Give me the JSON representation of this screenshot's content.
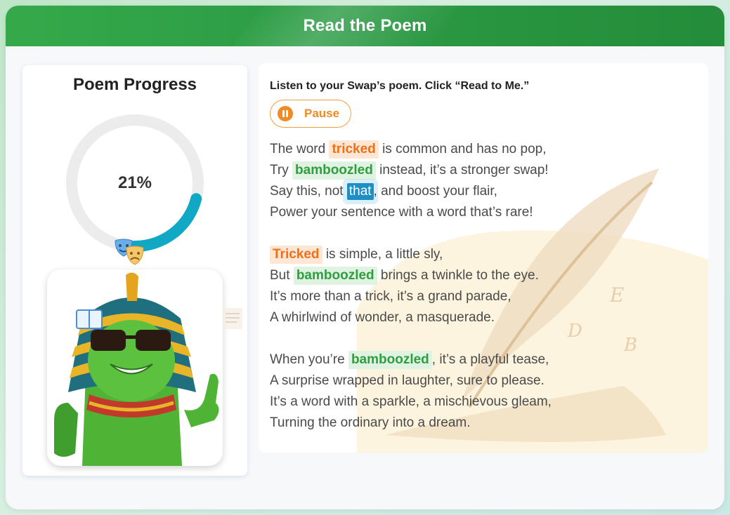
{
  "header": {
    "title": "Read the Poem"
  },
  "progress": {
    "title": "Poem Progress",
    "percent_label": "21%",
    "percent_value": 0.21,
    "ring_color": "#11a8c6",
    "track_color": "#ececec"
  },
  "reader": {
    "instruction": "Listen to your Swap’s poem. Click “Read to Me.”",
    "pause_label": "Pause"
  },
  "poem": {
    "lines": [
      {
        "pre": "The word ",
        "word": "tricked",
        "style": "orange",
        "post": " is common and has no pop,"
      },
      {
        "pre": "Try ",
        "word": "bamboozled",
        "style": "green",
        "post": " instead, it’s a stronger swap!"
      },
      {
        "pre": "Say this, not ",
        "word": "that",
        "style": "current",
        "post": ", and boost your flair,"
      },
      {
        "pre": "Power your sentence with a word that’s rare!",
        "word": "",
        "style": "",
        "post": ""
      },
      {
        "pre": "",
        "word": "Tricked",
        "style": "orange",
        "post": " is simple, a little sly,"
      },
      {
        "pre": "But ",
        "word": "bamboozled",
        "style": "green",
        "post": " brings a twinkle to the eye."
      },
      {
        "pre": "It’s more than a trick, it’s a grand parade,",
        "word": "",
        "style": "",
        "post": ""
      },
      {
        "pre": "A whirlwind of wonder, a masquerade.",
        "word": "",
        "style": "",
        "post": ""
      },
      {
        "pre": "When you’re ",
        "word": "bamboozled",
        "style": "green",
        "post": ", it’s a playful tease,"
      },
      {
        "pre": "A surprise wrapped in laughter, sure to please.",
        "word": "",
        "style": "",
        "post": ""
      },
      {
        "pre": "It’s a word with a sparkle, a mischievous gleam,",
        "word": "",
        "style": "",
        "post": ""
      },
      {
        "pre": "Turning the ordinary into a dream.",
        "word": "",
        "style": "",
        "post": ""
      }
    ]
  },
  "icons": {
    "masks": "theater-masks-icon",
    "avatar": "cactus-pharaoh-avatar",
    "pause": "pause-icon",
    "quill": "quill-decoration"
  },
  "colors": {
    "header_green": "#2c9b45",
    "accent_orange": "#f08a24",
    "highlight_green": "#2e9e3f",
    "current_word_blue": "#1d8fc2"
  }
}
